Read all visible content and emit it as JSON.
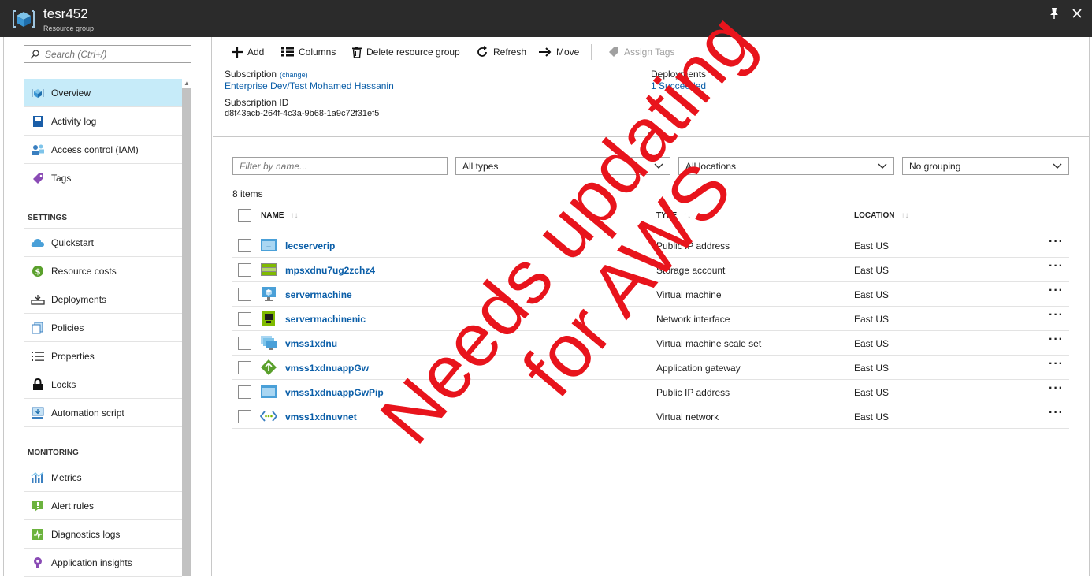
{
  "window": {
    "title": "tesr452",
    "subtitle": "Resource group",
    "pin_icon": "pin-icon",
    "close_icon": "close-icon"
  },
  "sidebar": {
    "search_placeholder": "Search (Ctrl+/)",
    "items_top": [
      {
        "label": "Overview",
        "icon": "overview-icon",
        "active": true
      },
      {
        "label": "Activity log",
        "icon": "activity-log-icon"
      },
      {
        "label": "Access control (IAM)",
        "icon": "access-control-icon"
      },
      {
        "label": "Tags",
        "icon": "tag-icon"
      }
    ],
    "settings_header": "SETTINGS",
    "items_settings": [
      {
        "label": "Quickstart",
        "icon": "quickstart-icon"
      },
      {
        "label": "Resource costs",
        "icon": "resource-costs-icon"
      },
      {
        "label": "Deployments",
        "icon": "deployments-icon"
      },
      {
        "label": "Policies",
        "icon": "policies-icon"
      },
      {
        "label": "Properties",
        "icon": "properties-icon"
      },
      {
        "label": "Locks",
        "icon": "lock-icon"
      },
      {
        "label": "Automation script",
        "icon": "automation-script-icon"
      }
    ],
    "monitoring_header": "MONITORING",
    "items_monitoring": [
      {
        "label": "Metrics",
        "icon": "metrics-icon"
      },
      {
        "label": "Alert rules",
        "icon": "alert-rules-icon"
      },
      {
        "label": "Diagnostics logs",
        "icon": "diagnostics-logs-icon"
      },
      {
        "label": "Application insights",
        "icon": "application-insights-icon"
      }
    ]
  },
  "toolbar": {
    "add": "Add",
    "columns": "Columns",
    "delete": "Delete resource group",
    "refresh": "Refresh",
    "move": "Move",
    "assign_tags": "Assign Tags"
  },
  "essentials": {
    "subscription_label": "Subscription",
    "subscription_change": "(change)",
    "subscription_value": "Enterprise Dev/Test Mohamed Hassanin",
    "subscription_id_label": "Subscription ID",
    "subscription_id_value": "d8f43acb-264f-4c3a-9b68-1a9c72f31ef5",
    "deployments_label": "Deployments",
    "deployments_value": "1 Succeeded"
  },
  "filters": {
    "name_placeholder": "Filter by name...",
    "types": "All types",
    "locations": "All locations",
    "grouping": "No grouping"
  },
  "item_count": "8 items",
  "grid": {
    "columns": {
      "name": "NAME",
      "type": "TYPE",
      "location": "LOCATION"
    },
    "rows": [
      {
        "name": "lecserverip",
        "type": "Public IP address",
        "location": "East US",
        "icon": "public-ip-icon"
      },
      {
        "name": "mpsxdnu7ug2zchz4",
        "type": "Storage account",
        "location": "East US",
        "icon": "storage-account-icon"
      },
      {
        "name": "servermachine",
        "type": "Virtual machine",
        "location": "East US",
        "icon": "virtual-machine-icon"
      },
      {
        "name": "servermachinenic",
        "type": "Network interface",
        "location": "East US",
        "icon": "network-interface-icon"
      },
      {
        "name": "vmss1xdnu",
        "type": "Virtual machine scale set",
        "location": "East US",
        "icon": "vm-scale-set-icon"
      },
      {
        "name": "vmss1xdnuappGw",
        "type": "Application gateway",
        "location": "East US",
        "icon": "application-gateway-icon"
      },
      {
        "name": "vmss1xdnuappGwPip",
        "type": "Public IP address",
        "location": "East US",
        "icon": "public-ip-icon"
      },
      {
        "name": "vmss1xdnuvnet",
        "type": "Virtual network",
        "location": "East US",
        "icon": "virtual-network-icon"
      }
    ]
  },
  "overlay": {
    "line1": "Needs updating",
    "line2": "for AWS",
    "color": "#e8141c"
  },
  "colors": {
    "title_bar": "#2b2b2b",
    "link": "#0a5ea8",
    "active_item": "#c6ebf9"
  }
}
